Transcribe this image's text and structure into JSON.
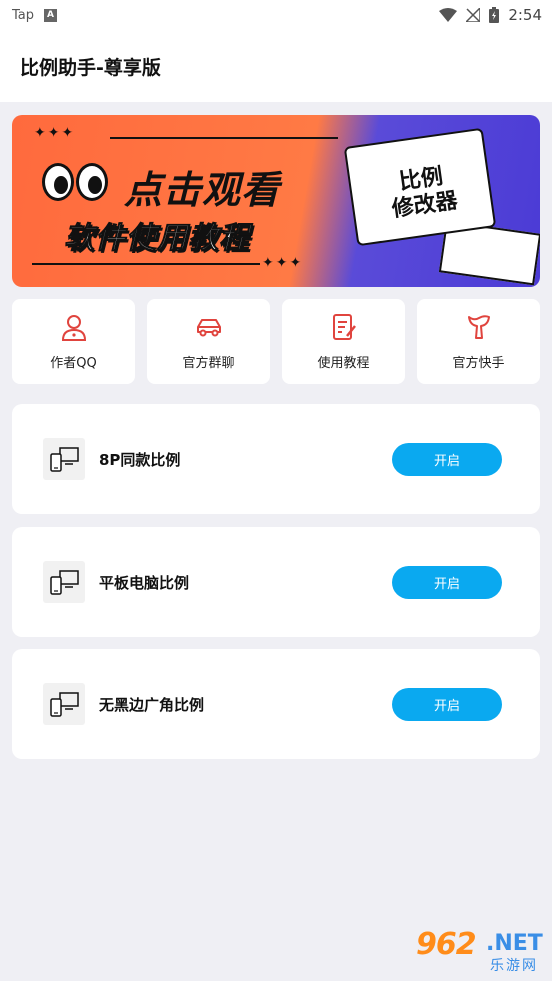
{
  "status_bar": {
    "app_label": "Tap",
    "time": "2:54"
  },
  "app_bar": {
    "title": "比例助手-尊享版"
  },
  "banner": {
    "headline": "点击观看",
    "subheadline": "软件使用教程",
    "paper_line1": "比例",
    "paper_line2": "修改器",
    "stars": "✦✦✦"
  },
  "quick_actions": [
    {
      "label": "作者QQ",
      "icon": "person-icon"
    },
    {
      "label": "官方群聊",
      "icon": "car-icon"
    },
    {
      "label": "使用教程",
      "icon": "edit-document-icon"
    },
    {
      "label": "官方快手",
      "icon": "kuaishou-icon"
    }
  ],
  "ratio_cards": [
    {
      "label": "8P同款比例",
      "button": "开启"
    },
    {
      "label": "平板电脑比例",
      "button": "开启"
    },
    {
      "label": "无黑边广角比例",
      "button": "开启"
    }
  ],
  "watermark": {
    "number": "962",
    "net": ".NET",
    "subtitle": "乐游网"
  },
  "colors": {
    "accent_button": "#0aa9f0",
    "icon_red": "#e0443e",
    "background": "#efeff4"
  }
}
